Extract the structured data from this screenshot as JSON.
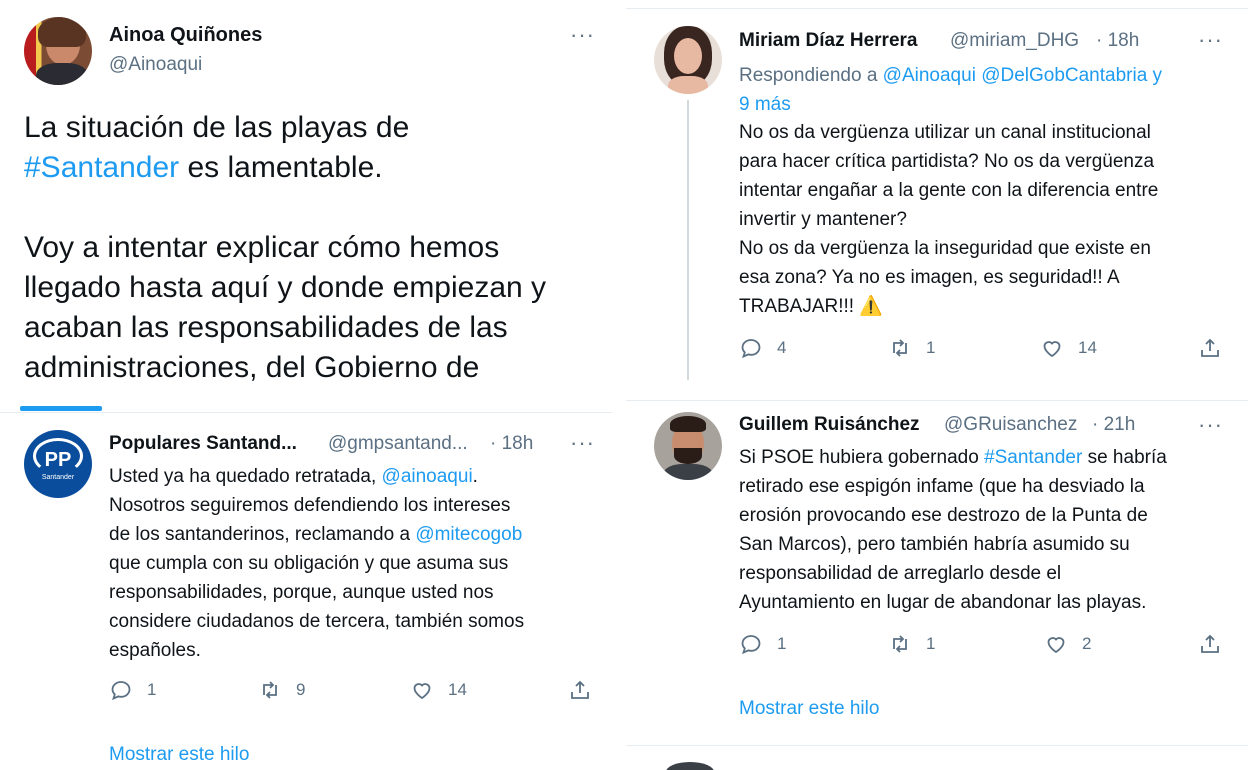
{
  "main_tweet": {
    "author_name": "Ainoa Quiñones",
    "author_handle": "@Ainoaqui",
    "text_line1": "La situación de las playas de",
    "hashtag": "#Santander",
    "text_line2_rest": " es lamentable.",
    "paragraph2": [
      "Voy a intentar explicar cómo hemos",
      "llegado hasta aquí y donde empiezan y",
      "acaban las responsabilidades de las",
      "administraciones, del Gobierno de"
    ]
  },
  "reply_pp": {
    "author_name": "Populares Santand...",
    "author_handle": "@gmpsantand...",
    "time": "· 18h",
    "avatar_text": "PP",
    "avatar_subtext": "Santander",
    "line1_pre": "Usted ya ha quedado retratada, ",
    "line1_mention": "@ainoaqui",
    "line1_post": ".",
    "line2": "Nosotros seguiremos defendiendo los intereses",
    "line3_pre": "de los santanderinos, reclamando a ",
    "line3_mention": "@mitecogob",
    "lines_rest": [
      "que cumpla con su obligación y que asuma sus",
      "responsabilidades, porque, aunque usted nos",
      "considere ciudadanos de tercera, también somos",
      "españoles."
    ],
    "replies": "1",
    "retweets": "9",
    "likes": "14",
    "show_thread": "Mostrar este hilo"
  },
  "reply_miriam": {
    "author_name": "Miriam Díaz Herrera",
    "author_handle": "@miriam_DHG",
    "time": "· 18h",
    "replying_prefix": "Respondiendo a ",
    "replying_mentions": "@Ainoaqui @DelGobCantabria y",
    "replying_more": "9 más",
    "lines": [
      "No os da vergüenza utilizar un canal institucional",
      "para hacer crítica partidista? No os da vergüenza",
      "intentar engañar a la gente con la diferencia entre",
      "invertir y mantener?",
      "No os da vergüenza la inseguridad que existe en",
      "esa zona? Ya no es imagen, es seguridad!! A"
    ],
    "last_line": "TRABAJAR!!!",
    "warning_emoji": "⚠️",
    "replies": "4",
    "retweets": "1",
    "likes": "14"
  },
  "reply_guillem": {
    "author_name": "Guillem Ruisánchez",
    "author_handle": "@GRuisanchez",
    "time": "· 21h",
    "line1_pre": "Si PSOE hubiera gobernado ",
    "line1_hashtag": "#Santander",
    "line1_post": " se habría",
    "lines": [
      "retirado ese espigón infame (que ha desviado la",
      "erosión provocando ese destrozo de la Punta de",
      "San Marcos), pero también habría asumido su",
      "responsabilidad de arreglarlo desde el",
      "Ayuntamiento en lugar de abandonar las playas."
    ],
    "replies": "1",
    "retweets": "1",
    "likes": "2",
    "show_thread": "Mostrar este hilo"
  },
  "colors": {
    "link": "#1d9bf0",
    "muted": "#5b7083",
    "pp_blue": "#0a4d9c"
  }
}
